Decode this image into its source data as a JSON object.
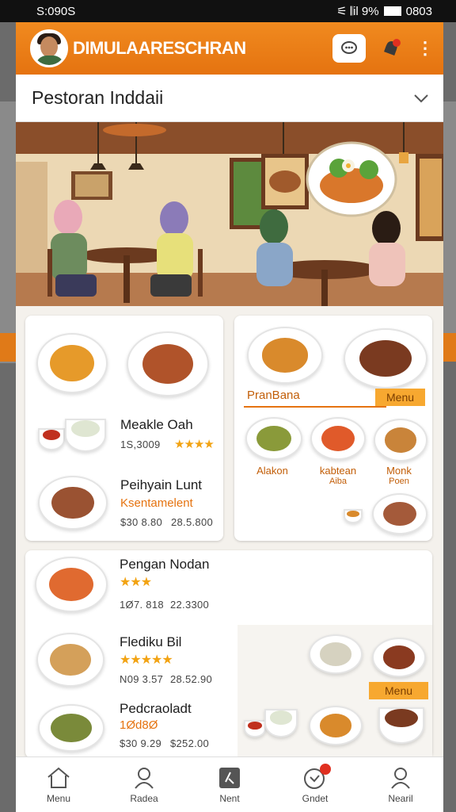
{
  "status_bar": {
    "time": "S:090S",
    "right": "⚟ 𝄃il 9%",
    "clock": "0803"
  },
  "app": {
    "title": "DIMULAARESCHRAN"
  },
  "selector": {
    "label": "Pestoran Inddaii"
  },
  "colors": {
    "primary": "#ec7d18",
    "accent_star": "#f2a313",
    "menu_tag": "#f7a830"
  },
  "card_left": {
    "items": [
      {
        "name": "Meakle Oah",
        "price": "1S,3009",
        "stars": "★★★★"
      },
      {
        "name": "Peihyain Lunt",
        "subtitle": "Ksentamelent",
        "price": "$30 8.80",
        "price2": "28.5.800"
      }
    ]
  },
  "card_right": {
    "section_label": "PranBana",
    "menu_tag": "Menu",
    "categories": [
      {
        "label": "Alakon",
        "sub": ""
      },
      {
        "label": "kabtean",
        "sub": "Aiba"
      },
      {
        "label": "Monk",
        "sub": "Poen"
      }
    ]
  },
  "card_bottom": {
    "items": [
      {
        "name": "Pengan Nodan",
        "stars": "★★★",
        "price": "1Ø7. 818",
        "price2": "22.3300"
      },
      {
        "name": "Flediku Bil",
        "stars": "★★★★★",
        "price": "N09 3.57",
        "price2": "28.52.90"
      },
      {
        "name": "Pedcraoladt",
        "subtitle": "1Ød8Ø",
        "price": "$30 9.29",
        "price2": "$252.00"
      }
    ],
    "menu_tag": "Menu"
  },
  "nav": [
    {
      "label": "Menu",
      "icon": "home-icon"
    },
    {
      "label": "Radea",
      "icon": "user-icon"
    },
    {
      "label": "Nent",
      "icon": "dish-icon"
    },
    {
      "label": "Gndet",
      "icon": "notification-icon"
    },
    {
      "label": "Nearil",
      "icon": "profile-icon"
    }
  ]
}
